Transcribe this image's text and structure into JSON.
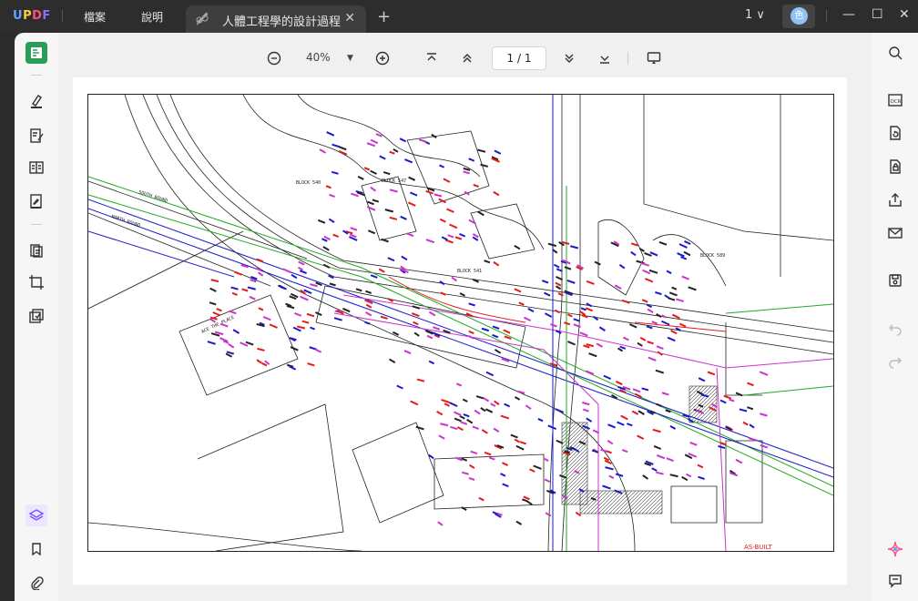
{
  "app": {
    "logo": "UPDF"
  },
  "menu": {
    "file": "檔案",
    "help": "說明"
  },
  "tab": {
    "title": "人體工程學的設計過程",
    "close": "✕"
  },
  "newtab": "+",
  "page_select": "1 ∨",
  "avatar_letter": "色",
  "window": {
    "minimize": "—",
    "maximize": "☐",
    "close": "✕"
  },
  "toolbar": {
    "zoom": "40%",
    "zoom_caret": "▼",
    "page": "1 / 1"
  },
  "colors": {
    "accent": "#2b9d5b",
    "titlebar": "#2d2d2d",
    "drawing_blue": "#1a1acc",
    "drawing_red": "#e61919",
    "drawing_green": "#22aa22",
    "drawing_magenta": "#cc33cc"
  },
  "drawing": {
    "labels": {
      "block540": "BLOCK 540",
      "block547": "BLOCK 547",
      "block541": "BLOCK 541",
      "block589": "BLOCK 589",
      "south_bound": "SOUTH BOUND",
      "north_bound": "NORTH BOUND",
      "ace": "ACE THE PLACE",
      "asbuilt": "AS-BUILT"
    }
  }
}
